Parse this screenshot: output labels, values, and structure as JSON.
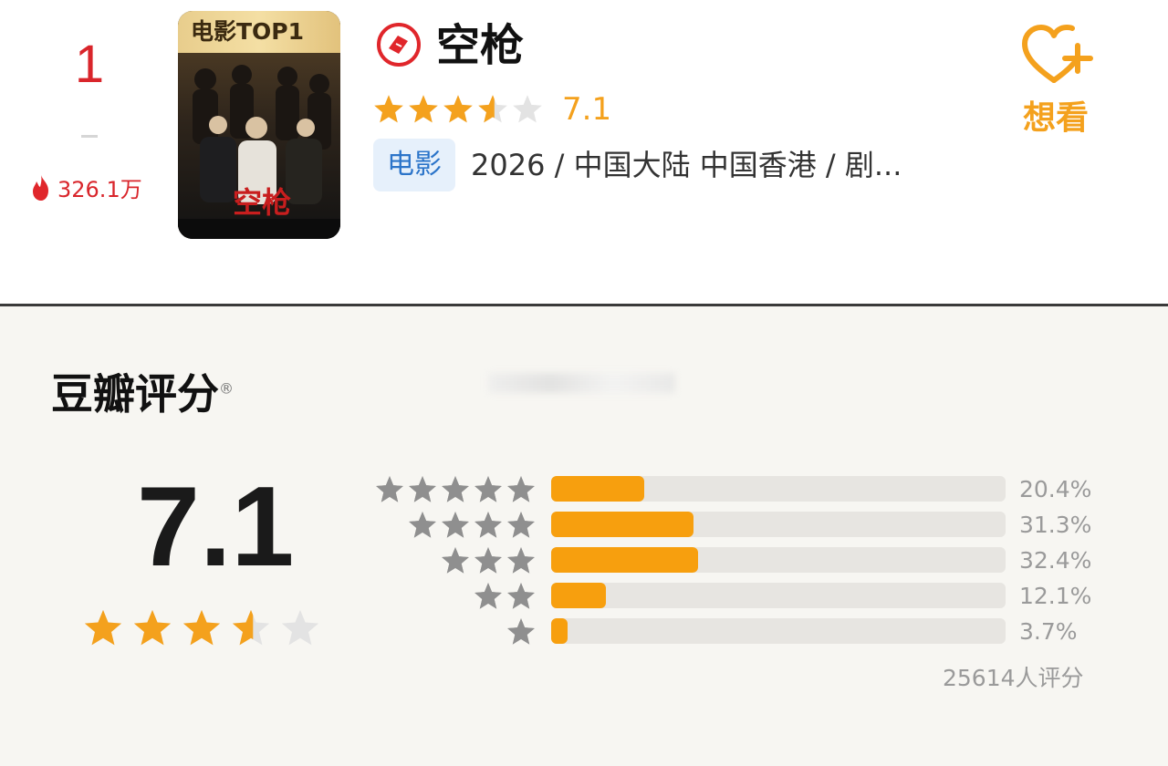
{
  "rank": {
    "number": "1",
    "hot_value": "326.1万",
    "hot_icon": "flame-icon"
  },
  "poster": {
    "badge": "电影TOP1",
    "title_text": "空枪"
  },
  "movie": {
    "title": "空枪",
    "title_icon": "ticket-icon",
    "rating": 7.1,
    "rating_text": "7.1",
    "type_tag": "电影",
    "meta": "2026 / 中国大陆 中国香港 / 剧..."
  },
  "want": {
    "label": "想看",
    "icon": "heart-plus-icon"
  },
  "douban": {
    "title": "豆瓣评分",
    "registered_mark": "®",
    "score": "7.1",
    "rating": 7.1,
    "distribution": [
      {
        "stars": 5,
        "percent": 20.4,
        "label": "20.4%"
      },
      {
        "stars": 4,
        "percent": 31.3,
        "label": "31.3%"
      },
      {
        "stars": 3,
        "percent": 32.4,
        "label": "32.4%"
      },
      {
        "stars": 2,
        "percent": 12.1,
        "label": "12.1%"
      },
      {
        "stars": 1,
        "percent": 3.7,
        "label": "3.7%"
      }
    ],
    "count_text": "25614人评分"
  },
  "colors": {
    "accent_orange": "#f79f0e",
    "star_gold": "#f4a11d",
    "rank_red": "#d9252b",
    "tag_blue": "#2b74c9"
  }
}
